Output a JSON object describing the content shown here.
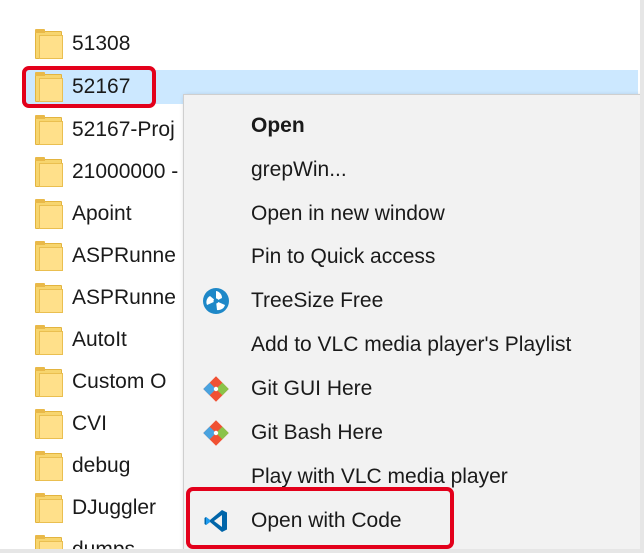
{
  "folders": [
    {
      "name": "51308"
    },
    {
      "name": "52167"
    },
    {
      "name": "52167-Proj"
    },
    {
      "name": "21000000 -"
    },
    {
      "name": "Apoint"
    },
    {
      "name": "ASPRunne"
    },
    {
      "name": "ASPRunne"
    },
    {
      "name": "AutoIt"
    },
    {
      "name": "Custom O"
    },
    {
      "name": "CVI"
    },
    {
      "name": "debug"
    },
    {
      "name": "DJuggler"
    },
    {
      "name": "dumps"
    }
  ],
  "selected_folder": "52167",
  "context_menu": {
    "items": [
      {
        "label": "Open",
        "icon": "",
        "default": true
      },
      {
        "label": "grepWin...",
        "icon": ""
      },
      {
        "label": "Open in new window",
        "icon": ""
      },
      {
        "label": "Pin to Quick access",
        "icon": ""
      },
      {
        "label": "TreeSize Free",
        "icon": "treesize-icon"
      },
      {
        "label": "Add to VLC media player's Playlist",
        "icon": ""
      },
      {
        "label": "Git GUI Here",
        "icon": "git-icon"
      },
      {
        "label": "Git Bash Here",
        "icon": "git-icon"
      },
      {
        "label": "Play with VLC media player",
        "icon": ""
      },
      {
        "label": "Open with Code",
        "icon": "vscode-icon"
      }
    ]
  },
  "colors": {
    "highlight": "#e3001b",
    "selection": "#cce8ff",
    "menu_background": "#f2f2f2",
    "vscode_blue": "#0065a9",
    "treesize_blue": "#1e88c8",
    "git_orange": "#f05133"
  }
}
